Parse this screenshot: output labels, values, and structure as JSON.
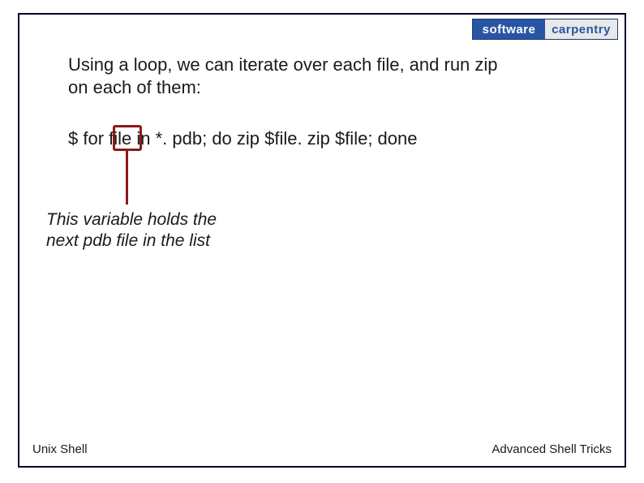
{
  "logo": {
    "left": "software",
    "right": "carpentry"
  },
  "intro": "Using a loop, we can iterate over each file, and run zip on each of them:",
  "code": "$ for file in *. pdb; do zip $file. zip $file; done",
  "note": "This variable holds the next pdb file in the list",
  "footer": {
    "left": "Unix Shell",
    "right": "Advanced Shell Tricks"
  }
}
